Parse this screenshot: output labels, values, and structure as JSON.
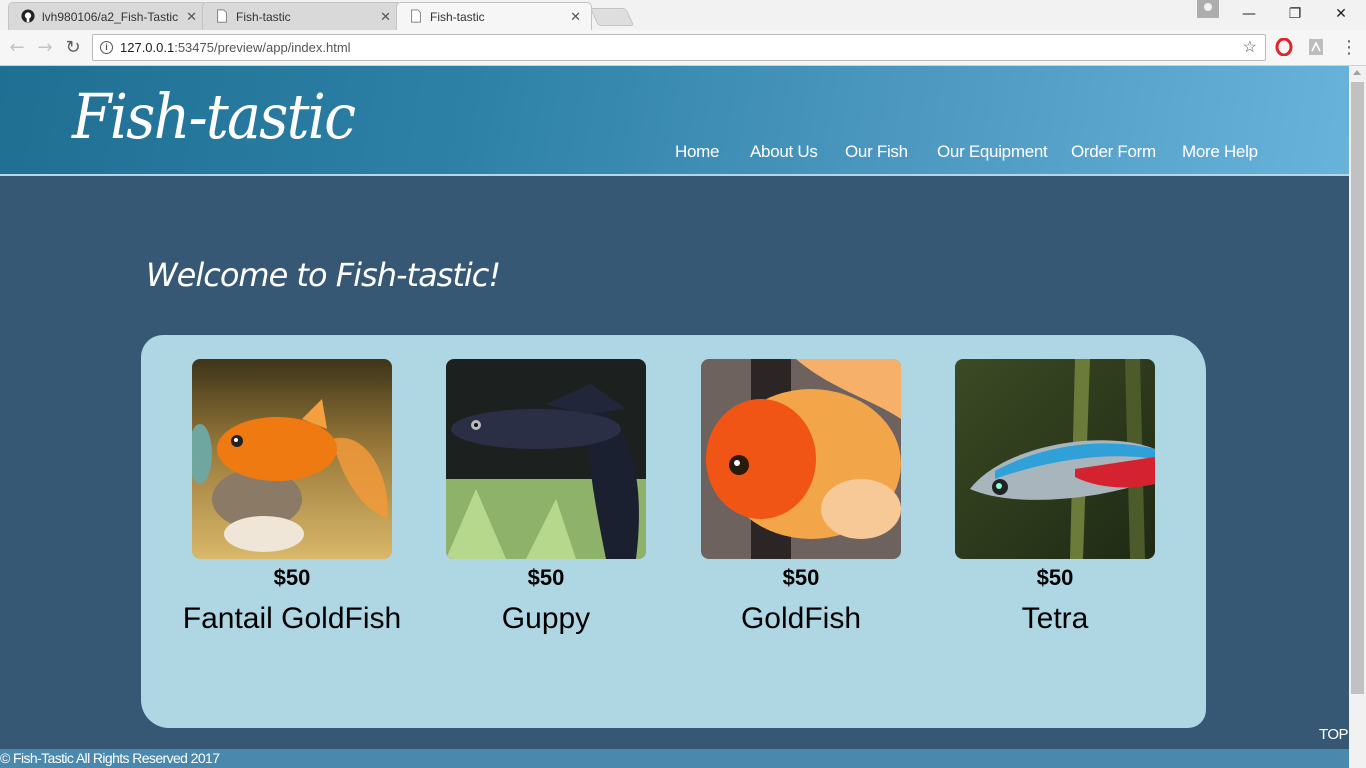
{
  "browser": {
    "tabs": [
      {
        "title": "lvh980106/a2_Fish-Tastic",
        "close": "✕"
      },
      {
        "title": "Fish-tastic",
        "close": "✕"
      },
      {
        "title": "Fish-tastic",
        "close": "✕"
      }
    ],
    "url_host": "127.0.0.1",
    "url_rest": ":53475/preview/app/index.html",
    "window_controls": {
      "minimize": "—",
      "restore": "❐",
      "close": "✕"
    },
    "nav": {
      "back": "←",
      "forward": "→",
      "reload": "↻",
      "menu": "⋮",
      "star": "☆",
      "info": "i"
    }
  },
  "site": {
    "logo": "Fish-tastic",
    "nav": [
      "Home",
      "About Us",
      "Our Fish",
      "Our Equipment",
      "Order Form",
      "More Help"
    ],
    "welcome": "Welcome to Fish-tastic!",
    "products": [
      {
        "price": "$50",
        "name": "Fantail GoldFish"
      },
      {
        "price": "$50",
        "name": "Guppy"
      },
      {
        "price": "$50",
        "name": "GoldFish"
      },
      {
        "price": "$50",
        "name": "Tetra"
      }
    ],
    "top_link": "TOP",
    "footer": "© Fish-Tastic All Rights Reserved 2017"
  },
  "colors": {
    "page_bg": "#365874",
    "panel_bg": "#aed6e3",
    "footer_bg": "#4a88ad"
  }
}
